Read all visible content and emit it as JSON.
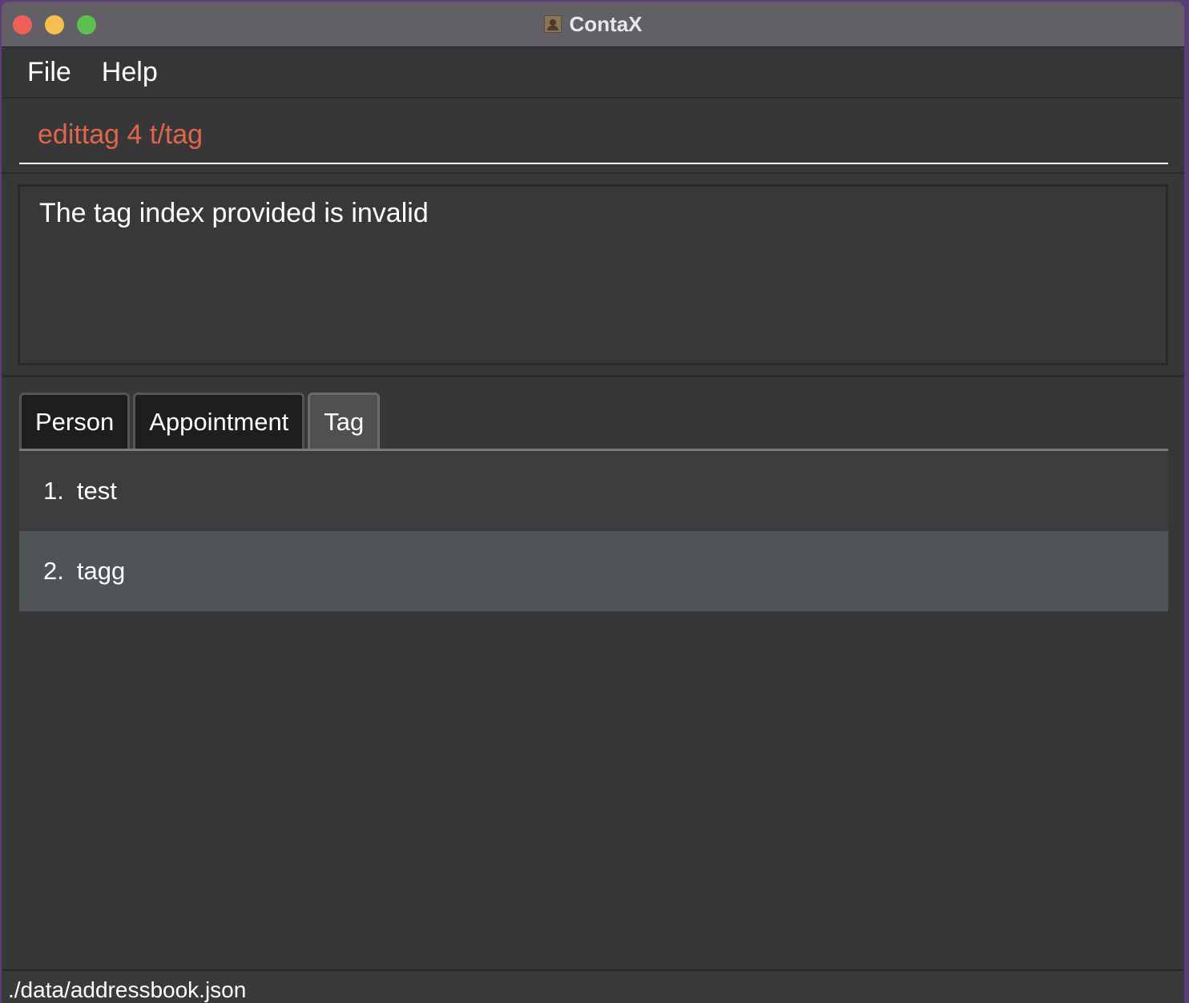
{
  "window": {
    "title": "ContaX",
    "app_icon": "contacts-app-icon"
  },
  "menubar": {
    "items": [
      {
        "label": "File"
      },
      {
        "label": "Help"
      }
    ]
  },
  "command": {
    "value": "edittag 4 t/tag",
    "color": "#e0654d"
  },
  "result": {
    "message": "The tag index provided is invalid"
  },
  "tabs": [
    {
      "label": "Person",
      "active": false
    },
    {
      "label": "Appointment",
      "active": false
    },
    {
      "label": "Tag",
      "active": true
    }
  ],
  "tag_list": [
    {
      "index": "1.",
      "name": "test"
    },
    {
      "index": "2.",
      "name": "tagg"
    }
  ],
  "status": {
    "path": "./data/addressbook.json"
  }
}
